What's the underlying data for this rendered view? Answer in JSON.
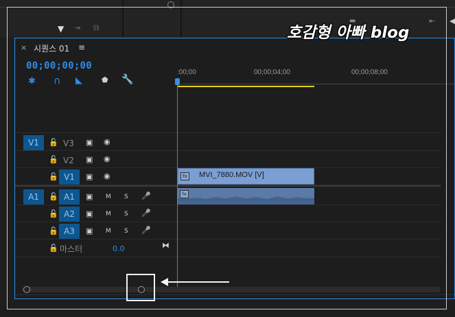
{
  "watermark": "호감형 아빠 blog",
  "sequence": {
    "close": "×",
    "title": "시퀀스 01",
    "menu": "≡",
    "timecode": "00;00;00;00"
  },
  "ruler": {
    "labels": [
      ":00;00",
      "00;00;04;00",
      "00;00;08;00"
    ]
  },
  "tracks": {
    "video": [
      {
        "target": "V1",
        "name": "V3",
        "source": ""
      },
      {
        "target": "",
        "name": "V2",
        "source": ""
      },
      {
        "target": "",
        "name": "",
        "source": "V1"
      }
    ],
    "audio": [
      {
        "target": "A1",
        "name": "",
        "source": "A1",
        "m": "M",
        "s": "S"
      },
      {
        "target": "",
        "name": "",
        "source": "A2",
        "m": "M",
        "s": "S"
      },
      {
        "target": "",
        "name": "",
        "source": "A3",
        "m": "M",
        "s": "S"
      }
    ],
    "master": {
      "label": "마스터",
      "value": "0.0"
    }
  },
  "clips": {
    "video_clip": "MVI_7880.MOV [V]",
    "fx": "fx"
  },
  "colors": {
    "accent": "#2d8ceb",
    "track_badge": "#0e5690",
    "clip_video": "#7b9ed3",
    "clip_audio": "#5a7aa8",
    "workarea": "#e6d21a"
  }
}
